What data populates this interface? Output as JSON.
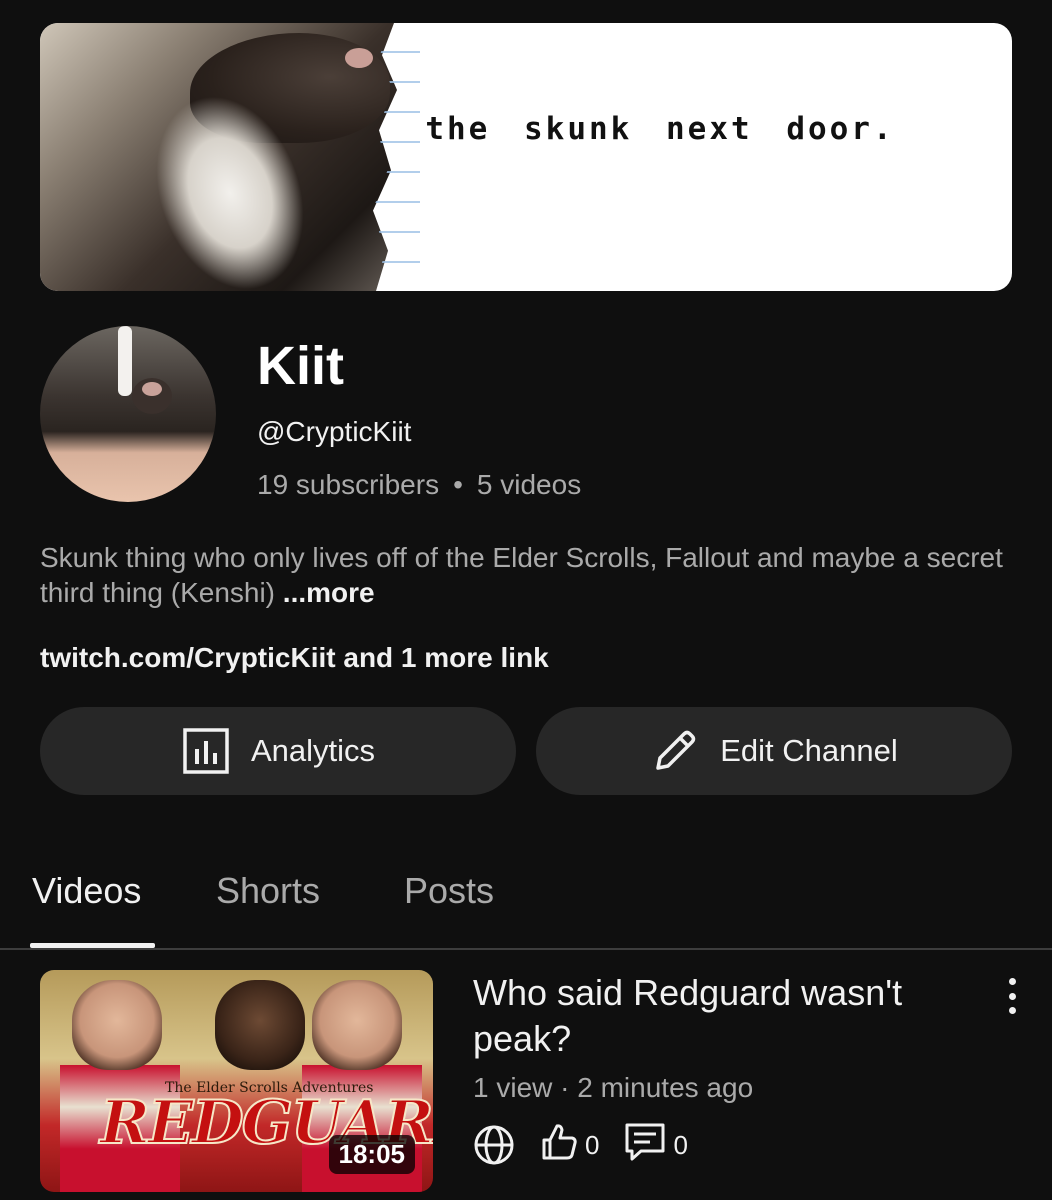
{
  "banner": {
    "text": "the skunk next door."
  },
  "channel": {
    "name": "Kiit",
    "handle": "@CrypticKiit",
    "subscribers": "19 subscribers",
    "separator": "•",
    "videos": "5 videos",
    "description": "Skunk thing who only lives off of the Elder Scrolls, Fallout and maybe a secret third thing (Kenshi) ",
    "more_label": "...more",
    "links": "twitch.com/CrypticKiit and 1 more link"
  },
  "buttons": {
    "analytics": "Analytics",
    "edit": "Edit Channel"
  },
  "tabs": [
    {
      "label": "Videos",
      "active": true
    },
    {
      "label": "Shorts",
      "active": false
    },
    {
      "label": "Posts",
      "active": false
    }
  ],
  "video": {
    "title": "Who said Redguard wasn't peak?",
    "meta": "1 view · 2 minutes ago",
    "duration": "18:05",
    "thumb_small_title": "The Elder Scrolls Adventures",
    "thumb_logo": "REDGUARD",
    "likes": "0",
    "comments": "0",
    "visibility_icon": "globe-icon"
  },
  "colors": {
    "background": "#0f0f0f",
    "button_bg": "#272727",
    "secondary_text": "#aaaaaa"
  }
}
